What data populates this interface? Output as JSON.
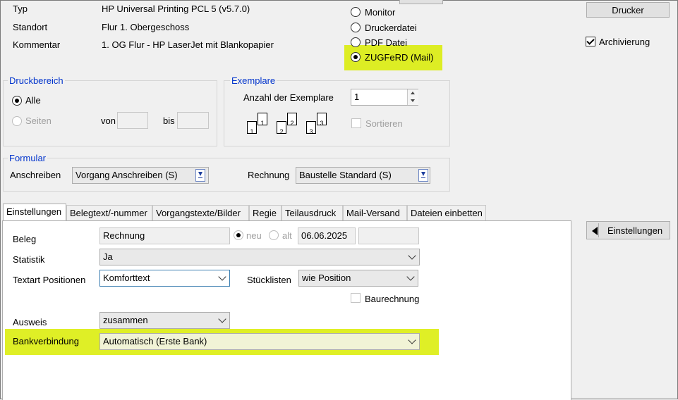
{
  "printer_info": {
    "type_label": "Typ",
    "type_value": "HP Universal Printing PCL 5 (v5.7.0)",
    "location_label": "Standort",
    "location_value": "Flur 1. Obergeschoss",
    "comment_label": "Kommentar",
    "comment_value": "1. OG Flur - HP LaserJet mit Blankopapier"
  },
  "output": {
    "monitor": "Monitor",
    "printer_file": "Druckerdatei",
    "pdf_file": "PDF Datei",
    "zugferd": "ZUGFeRD (Mail)",
    "selected": "ZUGFeRD (Mail)"
  },
  "right": {
    "printer_button": "Drucker",
    "archive_label": "Archivierung",
    "archive_checked": true,
    "settings_button": "Einstellungen"
  },
  "print_range": {
    "title": "Druckbereich",
    "all": "Alle",
    "pages": "Seiten",
    "from": "von",
    "to": "bis"
  },
  "copies": {
    "title": "Exemplare",
    "count_label": "Anzahl der Exemplare",
    "count_value": "1",
    "sort_label": "Sortieren"
  },
  "form": {
    "title": "Formular",
    "cover_label": "Anschreiben",
    "cover_value": "Vorgang Anschreiben (S)",
    "invoice_label": "Rechnung",
    "invoice_value": "Baustelle Standard (S)"
  },
  "tabs": [
    {
      "label": "Einstellungen"
    },
    {
      "label": "Belegtext/-nummer"
    },
    {
      "label": "Vorgangstexte/Bilder"
    },
    {
      "label": "Regie"
    },
    {
      "label": "Teilausdruck"
    },
    {
      "label": "Mail-Versand"
    },
    {
      "label": "Dateien einbetten"
    }
  ],
  "settings": {
    "doc_label": "Beleg",
    "doc_value": "Rechnung",
    "new_label": "neu",
    "old_label": "alt",
    "date_value": "06.06.2025",
    "stats_label": "Statistik",
    "stats_value": "Ja",
    "textart_label": "Textart Positionen",
    "textart_value": "Komforttext",
    "bom_label": "Stücklisten",
    "bom_value": "wie Position",
    "construction_invoice_label": "Baurechnung",
    "display_label": "Ausweis",
    "display_value": "zusammen",
    "bank_label": "Bankverbindung",
    "bank_value": "Automatisch (Erste Bank)"
  },
  "colors": {
    "highlight": "#d9ec00",
    "group_title": "#0033cc"
  }
}
